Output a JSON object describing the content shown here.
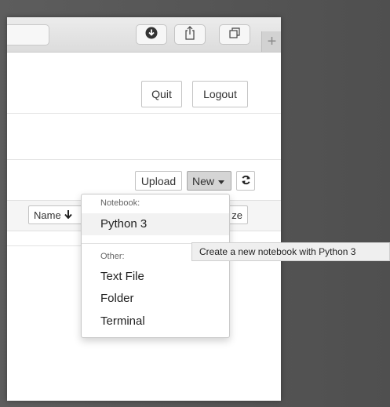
{
  "toolbar": {
    "download_icon": "download-icon",
    "share_icon": "share-icon",
    "tabs_icon": "tabs-icon",
    "new_tab_label": "+"
  },
  "header": {
    "quit_label": "Quit",
    "logout_label": "Logout"
  },
  "file_toolbar": {
    "upload_label": "Upload",
    "new_label": "New",
    "refresh_icon": "refresh-icon"
  },
  "list_header": {
    "name_label": "Name",
    "size_label_partial": "ze"
  },
  "new_menu": {
    "notebook_header": "Notebook:",
    "notebook_items": [
      "Python 3"
    ],
    "other_header": "Other:",
    "other_items": [
      "Text File",
      "Folder",
      "Terminal"
    ]
  },
  "tooltip": {
    "text": "Create a new notebook with Python 3"
  }
}
